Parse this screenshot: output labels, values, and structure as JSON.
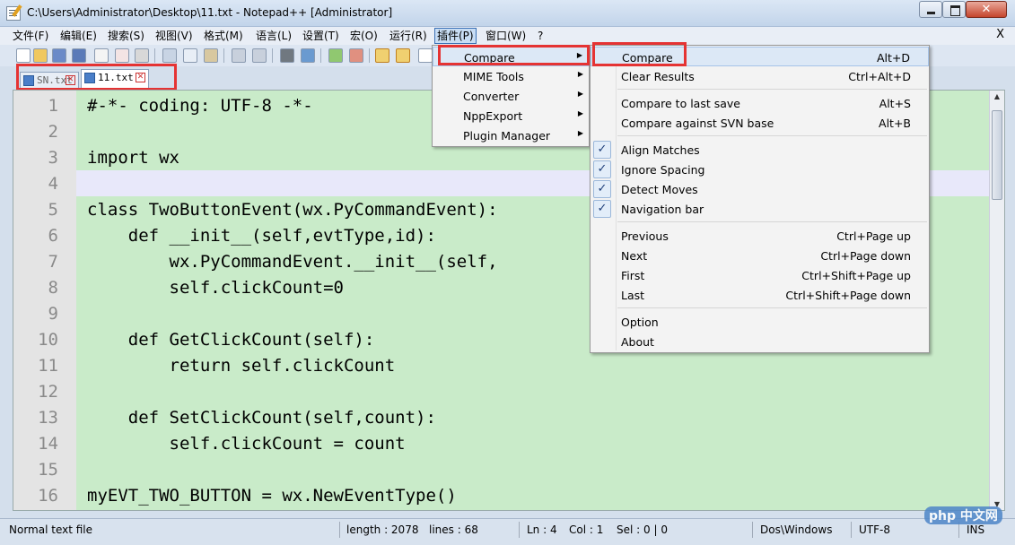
{
  "window": {
    "title": "C:\\Users\\Administrator\\Desktop\\11.txt - Notepad++ [Administrator]"
  },
  "menubar": {
    "items": [
      "文件(F)",
      "编辑(E)",
      "搜索(S)",
      "视图(V)",
      "格式(M)",
      "语言(L)",
      "设置(T)",
      "宏(O)",
      "运行(R)",
      "插件(P)",
      "窗口(W)",
      "?"
    ],
    "close": "X"
  },
  "tabs": [
    {
      "label": "SN.txt",
      "active": false
    },
    {
      "label": "11.txt",
      "active": true
    }
  ],
  "editor": {
    "line_numbers": [
      "1",
      "2",
      "3",
      "4",
      "5",
      "6",
      "7",
      "8",
      "9",
      "10",
      "11",
      "12",
      "13",
      "14",
      "15",
      "16"
    ],
    "lines": [
      "#-*- coding: UTF-8 -*-",
      "",
      "import wx",
      "",
      "class TwoButtonEvent(wx.PyCommandEvent):",
      "    def __init__(self,evtType,id):",
      "        wx.PyCommandEvent.__init__(self,",
      "        self.clickCount=0",
      "",
      "    def GetClickCount(self):",
      "        return self.clickCount",
      "",
      "    def SetClickCount(self,count):",
      "        self.clickCount = count",
      "",
      "myEVT_TWO_BUTTON = wx.NewEventType()"
    ],
    "current_line": 4
  },
  "plugins_menu": {
    "items": [
      "Compare",
      "MIME Tools",
      "Converter",
      "NppExport",
      "Plugin Manager"
    ],
    "highlighted": "Compare"
  },
  "compare_menu": {
    "groups": [
      [
        {
          "label": "Compare",
          "shortcut": "Alt+D"
        },
        {
          "label": "Clear Results",
          "shortcut": "Ctrl+Alt+D"
        }
      ],
      [
        {
          "label": "Compare to last save",
          "shortcut": "Alt+S"
        },
        {
          "label": "Compare against SVN base",
          "shortcut": "Alt+B"
        }
      ],
      [
        {
          "label": "Align Matches",
          "checked": true
        },
        {
          "label": "Ignore Spacing",
          "checked": true
        },
        {
          "label": "Detect Moves",
          "checked": true
        },
        {
          "label": "Navigation bar",
          "checked": true
        }
      ],
      [
        {
          "label": "Previous",
          "shortcut": "Ctrl+Page up"
        },
        {
          "label": "Next",
          "shortcut": "Ctrl+Page down"
        },
        {
          "label": "First",
          "shortcut": "Ctrl+Shift+Page up"
        },
        {
          "label": "Last",
          "shortcut": "Ctrl+Shift+Page down"
        }
      ],
      [
        {
          "label": "Option",
          "shortcut": ""
        },
        {
          "label": "About",
          "shortcut": ""
        }
      ]
    ],
    "checkmark": "✓"
  },
  "statusbar": {
    "file_type": "Normal text file",
    "length": "length : 2078",
    "lines": "lines : 68",
    "ln": "Ln : 4",
    "col": "Col : 1",
    "sel": "Sel : 0 | 0",
    "eol": "Dos\\Windows",
    "encoding": "UTF-8",
    "mode": "INS"
  },
  "watermark": "php 中文网",
  "colors": {
    "highlight_red": "#e53333",
    "code_bg": "#c9ebc9",
    "current_line": "#e8e8fa"
  }
}
